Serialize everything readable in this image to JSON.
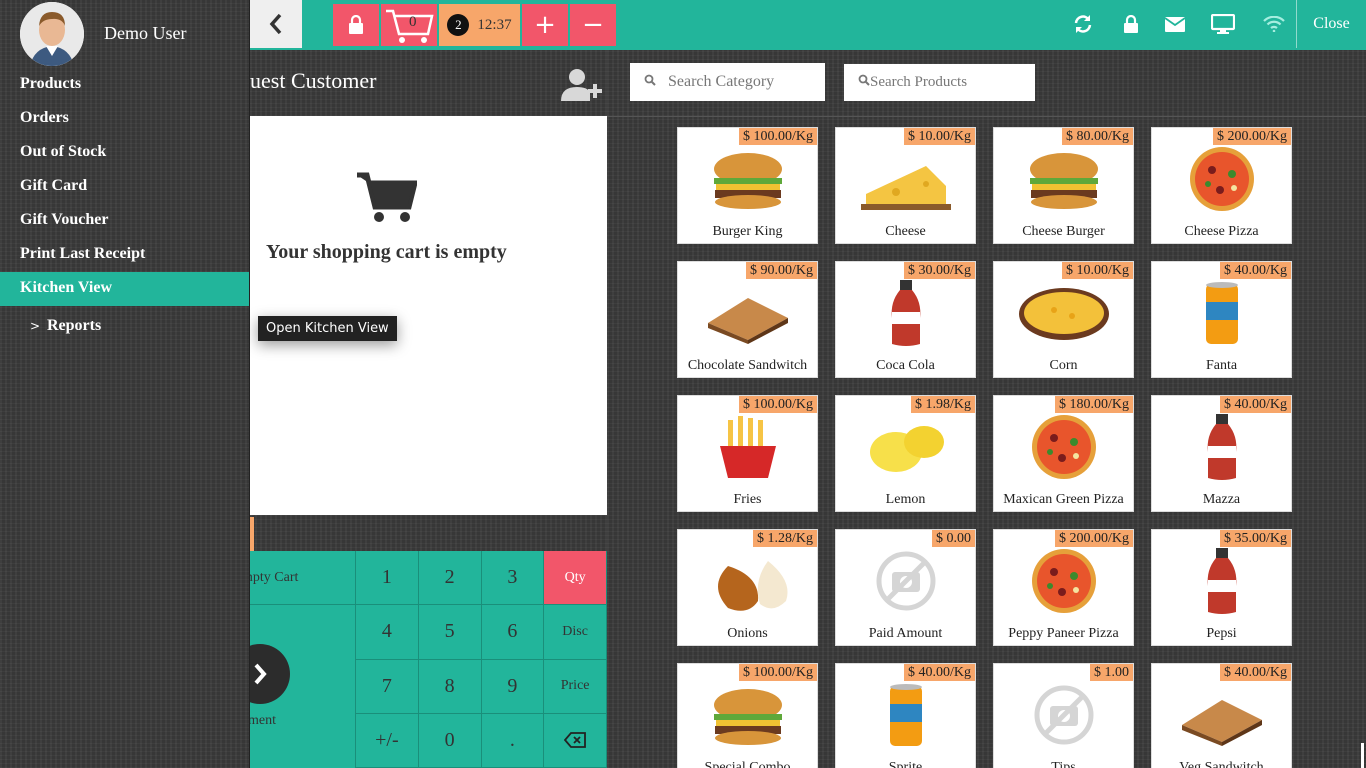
{
  "sidebar": {
    "user_name": "Demo User",
    "items": [
      {
        "label": "Products"
      },
      {
        "label": "Orders"
      },
      {
        "label": "Out of Stock"
      },
      {
        "label": "Gift Card"
      },
      {
        "label": "Gift Voucher"
      },
      {
        "label": "Print Last Receipt"
      },
      {
        "label": "Kitchen View",
        "active": true
      },
      {
        "label": "Reports"
      }
    ]
  },
  "topbar": {
    "cart_count": "0",
    "order_count": "2",
    "time": "12:37",
    "plus": "+",
    "minus": "−",
    "close_label": "Close",
    "icons": [
      "back-icon",
      "lock-icon",
      "cart-icon",
      "refresh-icon",
      "lock-icon",
      "mail-icon",
      "monitor-icon",
      "wifi-icon"
    ]
  },
  "cart": {
    "customer": "uest Customer",
    "empty_text": "Your shopping cart is empty",
    "tooltip": "Open Kitchen View",
    "empty_cart_label": "mpty Cart",
    "payment_label": "yment"
  },
  "numpad": {
    "keys": [
      "1",
      "2",
      "3",
      "Qty",
      "4",
      "5",
      "6",
      "Disc",
      "7",
      "8",
      "9",
      "Price",
      "+/-",
      "0",
      ".",
      "⌫"
    ]
  },
  "search": {
    "category_placeholder": "Search Category",
    "product_placeholder": "Search Products"
  },
  "products": [
    {
      "name": "Burger King",
      "price": "$ 100.00/Kg",
      "icon": "burger"
    },
    {
      "name": "Cheese",
      "price": "$ 10.00/Kg",
      "icon": "cheese"
    },
    {
      "name": "Cheese Burger",
      "price": "$ 80.00/Kg",
      "icon": "burger"
    },
    {
      "name": "Cheese Pizza",
      "price": "$ 200.00/Kg",
      "icon": "pizza"
    },
    {
      "name": "Chocolate Sandwitch",
      "price": "$ 90.00/Kg",
      "icon": "sandwich"
    },
    {
      "name": "Coca Cola",
      "price": "$ 30.00/Kg",
      "icon": "bottle"
    },
    {
      "name": "Corn",
      "price": "$ 10.00/Kg",
      "icon": "corn"
    },
    {
      "name": "Fanta",
      "price": "$ 40.00/Kg",
      "icon": "can"
    },
    {
      "name": "Fries",
      "price": "$ 100.00/Kg",
      "icon": "fries"
    },
    {
      "name": "Lemon",
      "price": "$ 1.98/Kg",
      "icon": "lemon"
    },
    {
      "name": "Maxican Green Pizza",
      "price": "$ 180.00/Kg",
      "icon": "pizza"
    },
    {
      "name": "Mazza",
      "price": "$ 40.00/Kg",
      "icon": "bottle"
    },
    {
      "name": "Onions",
      "price": "$ 1.28/Kg",
      "icon": "onion"
    },
    {
      "name": "Paid Amount",
      "price": "$ 0.00",
      "icon": "nophoto"
    },
    {
      "name": "Peppy Paneer Pizza",
      "price": "$ 200.00/Kg",
      "icon": "pizza"
    },
    {
      "name": "Pepsi",
      "price": "$ 35.00/Kg",
      "icon": "bottle"
    },
    {
      "name": "Special Combo",
      "price": "$ 100.00/Kg",
      "icon": "burger"
    },
    {
      "name": "Sprite",
      "price": "$ 40.00/Kg",
      "icon": "can"
    },
    {
      "name": "Tips",
      "price": "$ 1.00",
      "icon": "nophoto"
    },
    {
      "name": "Veg Sandwitch",
      "price": "$ 40.00/Kg",
      "icon": "sandwich"
    }
  ]
}
